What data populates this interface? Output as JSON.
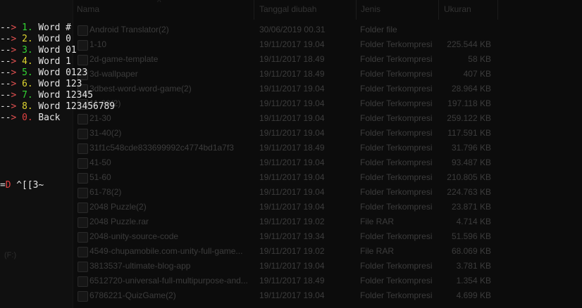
{
  "explorer": {
    "columns": {
      "name": "Nama",
      "date": "Tanggal diubah",
      "type": "Jenis",
      "size": "Ukuran"
    },
    "sidebar_item": "(F:)",
    "files": [
      {
        "name": "Android Translator(2)",
        "date": "30/06/2019 00.31",
        "type": "Folder file",
        "size": ""
      },
      {
        "name": "1-10",
        "date": "19/11/2017 19.04",
        "type": "Folder Terkompresi",
        "size": "225.544 KB"
      },
      {
        "name": "2d-game-template",
        "date": "19/11/2017 18.49",
        "type": "Folder Terkompresi",
        "size": "58 KB"
      },
      {
        "name": "3d-wallpaper",
        "date": "19/11/2017 18.49",
        "type": "Folder Terkompresi",
        "size": "407 KB"
      },
      {
        "name": "3dbest-word-word-game(2)",
        "date": "19/11/2017 19.04",
        "type": "Folder Terkompresi",
        "size": "28.964 KB"
      },
      {
        "name": "11-20(2)",
        "date": "19/11/2017 19.04",
        "type": "Folder Terkompresi",
        "size": "197.118 KB"
      },
      {
        "name": "21-30",
        "date": "19/11/2017 19.04",
        "type": "Folder Terkompresi",
        "size": "259.122 KB"
      },
      {
        "name": "31-40(2)",
        "date": "19/11/2017 19.04",
        "type": "Folder Terkompresi",
        "size": "117.591 KB"
      },
      {
        "name": "31f1c548cde833699992c4774bd1a7f3",
        "date": "19/11/2017 18.49",
        "type": "Folder Terkompresi",
        "size": "31.796 KB"
      },
      {
        "name": "41-50",
        "date": "19/11/2017 19.04",
        "type": "Folder Terkompresi",
        "size": "93.487 KB"
      },
      {
        "name": "51-60",
        "date": "19/11/2017 19.04",
        "type": "Folder Terkompresi",
        "size": "210.805 KB"
      },
      {
        "name": "61-78(2)",
        "date": "19/11/2017 19.04",
        "type": "Folder Terkompresi",
        "size": "224.763 KB"
      },
      {
        "name": "2048 Puzzle(2)",
        "date": "19/11/2017 19.04",
        "type": "Folder Terkompresi",
        "size": "23.871 KB"
      },
      {
        "name": "2048 Puzzle.rar",
        "date": "19/11/2017 19.02",
        "type": "File RAR",
        "size": "4.714 KB"
      },
      {
        "name": "2048-unity-source-code",
        "date": "19/11/2017 19.34",
        "type": "Folder Terkompresi",
        "size": "51.596 KB"
      },
      {
        "name": "4549-chupamobile.com-unity-full-game...",
        "date": "19/11/2017 19.02",
        "type": "File RAR",
        "size": "68.069 KB"
      },
      {
        "name": "3813537-ultimate-blog-app",
        "date": "19/11/2017 19.04",
        "type": "Folder Terkompresi",
        "size": "3.781 KB"
      },
      {
        "name": "6512720-universal-full-multipurpose-and...",
        "date": "19/11/2017 18.49",
        "type": "Folder Terkompresi",
        "size": "1.354 KB"
      },
      {
        "name": "6786221-QuizGame(2)",
        "date": "19/11/2017 19.04",
        "type": "Folder Terkompresi",
        "size": "4.699 KB"
      }
    ]
  },
  "terminal": {
    "arrow": "-->",
    "menu": [
      {
        "num": "1.",
        "label": "Word #",
        "color": "green"
      },
      {
        "num": "2.",
        "label": "Word 0",
        "color": "yellow"
      },
      {
        "num": "3.",
        "label": "Word 01",
        "color": "green"
      },
      {
        "num": "4.",
        "label": "Word 1",
        "color": "yellow"
      },
      {
        "num": "5.",
        "label": "Word 0123",
        "color": "green"
      },
      {
        "num": "6.",
        "label": "Word 123",
        "color": "yellow"
      },
      {
        "num": "7.",
        "label": "Word 12345",
        "color": "green"
      },
      {
        "num": "8.",
        "label": "Word 123456789",
        "color": "yellow"
      },
      {
        "num": "0.",
        "label": "Back",
        "color": "red"
      }
    ],
    "prompt_eq": "=",
    "prompt_d": "D",
    "input": " ^[[3~"
  }
}
